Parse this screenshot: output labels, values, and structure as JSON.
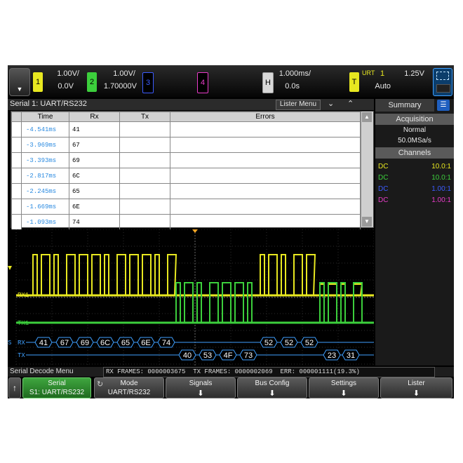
{
  "topbar": {
    "ch1": {
      "num": "1",
      "scale": "1.00V/",
      "offset": "0.0V",
      "color": "#e8e820"
    },
    "ch2": {
      "num": "2",
      "scale": "1.00V/",
      "offset": "1.70000V",
      "color": "#3ccf3c"
    },
    "ch3": {
      "num": "3",
      "color": "#3c5cff"
    },
    "ch4": {
      "num": "4",
      "color": "#e83cc8"
    },
    "horizontal": {
      "label": "H",
      "scale": "1.000ms/",
      "position": "0.0s"
    },
    "trigger": {
      "label": "T",
      "source": "URT",
      "channel": "1",
      "level": "1.25V",
      "mode": "Auto"
    }
  },
  "lister": {
    "title": "Serial 1: UART/RS232",
    "menu_label": "Lister Menu",
    "columns": [
      "Time",
      "Rx",
      "Tx",
      "Errors"
    ],
    "rows": [
      {
        "time": "-4.541ms",
        "rx": "41",
        "tx": "",
        "errors": ""
      },
      {
        "time": "-3.969ms",
        "rx": "67",
        "tx": "",
        "errors": ""
      },
      {
        "time": "-3.393ms",
        "rx": "69",
        "tx": "",
        "errors": ""
      },
      {
        "time": "-2.817ms",
        "rx": "6C",
        "tx": "",
        "errors": ""
      },
      {
        "time": "-2.245ms",
        "rx": "65",
        "tx": "",
        "errors": ""
      },
      {
        "time": "-1.669ms",
        "rx": "6E",
        "tx": "",
        "errors": ""
      },
      {
        "time": "-1.093ms",
        "rx": "74",
        "tx": "",
        "errors": ""
      }
    ]
  },
  "side_panel": {
    "tab": "Summary",
    "acquisition_header": "Acquisition",
    "mode": "Normal",
    "sample_rate": "50.0MSa/s",
    "channels_header": "Channels",
    "channels": [
      {
        "coupling": "DC",
        "probe": "10.0:1",
        "color": "#e8e820"
      },
      {
        "coupling": "DC",
        "probe": "10.0:1",
        "color": "#3ccf3c"
      },
      {
        "coupling": "DC",
        "probe": "1.00:1",
        "color": "#3c5cff"
      },
      {
        "coupling": "DC",
        "probe": "1.00:1",
        "color": "#e83cc8"
      }
    ]
  },
  "waveform": {
    "rx_label": "RX1",
    "tx_label": "TX1",
    "bus_rx": "RX",
    "bus_tx": "TX",
    "s1_marker": "S",
    "rx_bytes": [
      "41",
      "67",
      "69",
      "6C",
      "65",
      "6E",
      "74",
      "52",
      "52",
      "52"
    ],
    "tx_bytes": [
      "40",
      "53",
      "4F",
      "73",
      "23",
      "31"
    ]
  },
  "status": {
    "menu_title": "Serial Decode Menu",
    "counters": "RX FRAMES: 0000003675  TX FRAMES: 0000002069  ERR: 000001111(19.3%)"
  },
  "softkeys": [
    {
      "title": "Serial",
      "value": "S1: UART/RS232"
    },
    {
      "title": "Mode",
      "value": "UART/RS232"
    },
    {
      "title": "Signals",
      "value": ""
    },
    {
      "title": "Bus Config",
      "value": ""
    },
    {
      "title": "Settings",
      "value": ""
    },
    {
      "title": "Lister",
      "value": ""
    }
  ]
}
